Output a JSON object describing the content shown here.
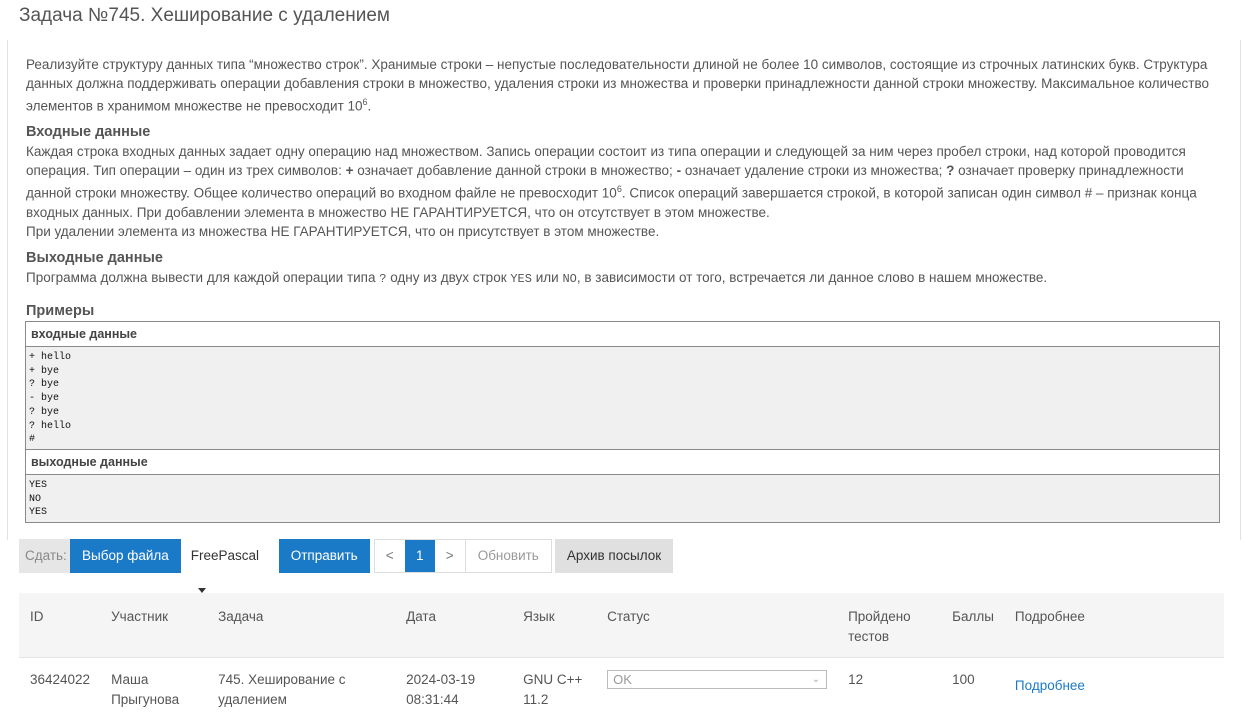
{
  "page_title": "Задача №745. Хеширование с удалением",
  "statement": {
    "p1": "Реализуйте структуру данных типа “множество строк”. Хранимые строки  – непустые последовательности  длиной не более 10 символов, состоящие из строчных латинских букв. Структура данных должна поддерживать операции добавления строки в множество, удаления строки из множества и проверки принадлежности данной строки множеству. Максимальное количество элементов в хранимом множестве не превосходит 10",
    "p1_sup": "6",
    "p1_end": ".",
    "input_heading": "Входные данные",
    "input_a": "Каждая строка входных данных задает одну операцию над множеством. Запись операции состоит из типа операции и следующей за ним через пробел строки, над которой проводится операция. Тип операции  – один из трех символов:    ",
    "op_plus": "+",
    "input_b": "  означает добавление данной строки в множество;    ",
    "op_minus": "-",
    "input_c": "  означает удаление  строки из множества;     ",
    "op_q": "?",
    "input_d": "  означает проверку принадлежности данной строки множеству. Общее количество операций во входном файле не превосходит 10",
    "input_sup": "6",
    "input_e": ". Список операций завершается строкой, в которой записан один символ # – признак конца входных данных. При добавлении элемента в множество НЕ ГАРАНТИРУЕТСЯ, что он отсутствует в этом множестве.",
    "input_f": "При удалении элемента из множества НЕ ГАРАНТИРУЕТСЯ, что он присутствует в этом множестве.",
    "output_heading": "Выходные данные",
    "output_a": "Программа должна вывести для каждой операции типа ",
    "output_q": "?",
    "output_b": " одну из двух строк ",
    "output_yes": "YES",
    "output_c": " или ",
    "output_no": "NO",
    "output_d": ", в зависимости от того, встречается ли данное слово в нашем множестве.",
    "examples_heading": "Примеры",
    "input_label": "входные данные",
    "input_sample": "+ hello\n+ bye\n? bye\n- bye\n? bye\n? hello\n#",
    "output_label": "выходные данные",
    "output_sample": "YES\nNO\nYES"
  },
  "toolbar": {
    "submit_label": "Сдать:",
    "choose_file": "Выбор файла",
    "language": "FreePascal",
    "send": "Отправить",
    "prev": "<",
    "page": "1",
    "next": ">",
    "refresh": "Обновить",
    "archive": "Архив посылок"
  },
  "submissions": {
    "headers": [
      "ID",
      "Участник",
      "Задача",
      "Дата",
      "Язык",
      "Статус",
      "Пройдено тестов",
      "Баллы",
      "Подробнее"
    ],
    "rows": [
      {
        "id": "36424022",
        "user": "Маша Прыгунова",
        "problem": "745. Хеширование с удалением",
        "date": "2024-03-19 08:31:44",
        "lang": "GNU C++ 11.2",
        "status": "OK",
        "tests": "12",
        "score": "100",
        "details": "Подробнее"
      }
    ]
  }
}
